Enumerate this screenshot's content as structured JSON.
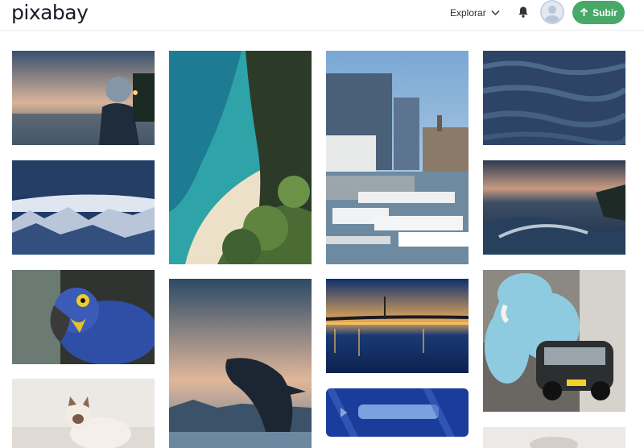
{
  "header": {
    "logo": "pixabay",
    "explore_label": "Explorar",
    "upload_label": "Subir"
  },
  "colors": {
    "accent": "#48a868",
    "text": "#191b26"
  },
  "icons": {
    "explore": "chevron-down-icon",
    "notifications": "bell-icon",
    "avatar": "user-avatar-icon",
    "upload": "upload-arrow-icon"
  },
  "gallery": {
    "columns": 4,
    "images": [
      "woman-with-helmet-on-quay-at-dusk",
      "snowy-mountains-under-dark-sky",
      "blue-hyacinth-macaw-parrot",
      "siamese-cat",
      "aerial-beach-turquoise-water-and-cliff",
      "humpback-whale-breaching-at-sunset",
      "marina-with-boats-and-city-buildings",
      "bridge-reflecting-on-river-at-night",
      "blurred-banner-image",
      "water-surface-ripples",
      "stormy-sea-and-cliffs",
      "cartoon-elephant-with-vintage-car"
    ]
  }
}
